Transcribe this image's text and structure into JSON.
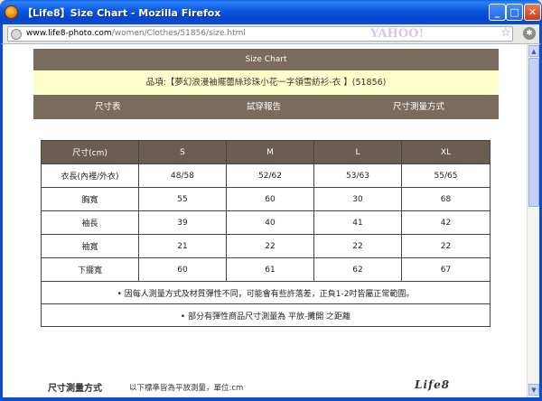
{
  "window": {
    "title": "【Life8】Size Chart - Mozilla Firefox",
    "url_domain": "www.life8-photo.com",
    "url_path": "/women/Clothes/51856/size.html",
    "search_brand": "YAHOO!"
  },
  "page": {
    "header_title": "Size Chart",
    "product_line": "品項:【夢幻浪漫袖擺蕾絲珍珠小花一字領雪紡衫-衣 】(51856)",
    "tabs": [
      "尺寸表",
      "試穿報告",
      "尺寸測量方式"
    ],
    "footer_title": "尺寸測量方式",
    "footer_note": "以下標準皆為平放測量，單位:cm",
    "logo_text": "Life8"
  },
  "size_table": {
    "headers": [
      "尺寸(cm)",
      "S",
      "M",
      "L",
      "XL"
    ],
    "rows": [
      [
        "衣長(內裡/外衣)",
        "48/58",
        "52/62",
        "53/63",
        "55/65"
      ],
      [
        "胸寬",
        "55",
        "60",
        "30",
        "68"
      ],
      [
        "袖長",
        "39",
        "40",
        "41",
        "42"
      ],
      [
        "袖寬",
        "21",
        "22",
        "22",
        "22"
      ],
      [
        "下擺寬",
        "60",
        "61",
        "62",
        "67"
      ]
    ],
    "notes": [
      "• 因每人測量方式及材質彈性不同，可能會有些許落差，正負1-2吋皆屬正常範圍。",
      "• 部分有彈性商品尺寸測量為 平放-攤開 之距離"
    ]
  },
  "colors": {
    "header_bg": "#7a6b5d",
    "product_bg": "#ffffcc",
    "table_head_bg": "#6a5d52",
    "titlebar": "#0b56de"
  },
  "icons": {
    "app": "firefox-icon",
    "minimize": "minimize-icon",
    "maximize": "maximize-icon",
    "close": "close-icon",
    "bookmark": "star-icon",
    "addon": "gear-icon"
  }
}
